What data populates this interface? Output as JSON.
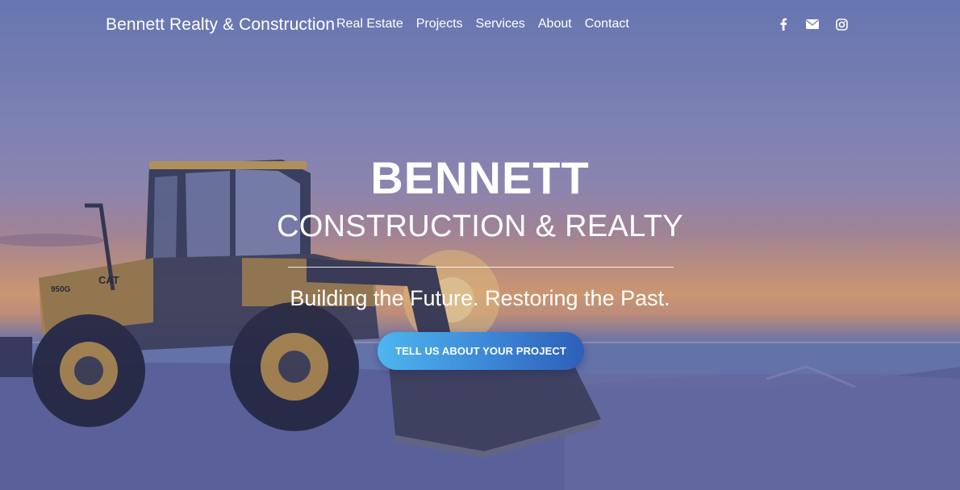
{
  "header": {
    "brand": "Bennett Realty & Construction",
    "nav": [
      "Real Estate",
      "Projects",
      "Services",
      "About",
      "Contact"
    ],
    "social": [
      {
        "icon": "facebook-icon",
        "label": "f"
      },
      {
        "icon": "envelope-icon"
      },
      {
        "icon": "instagram-icon"
      }
    ]
  },
  "hero": {
    "title": "BENNETT",
    "subtitle": "CONSTRUCTION & REALTY",
    "tagline": "Building the Future. Restoring the Past.",
    "cta_label": "TELL US ABOUT YOUR PROJECT",
    "loader_model": "950G",
    "loader_brand": "CAT",
    "background_image": "wheel-loader-on-beach-at-sunset"
  },
  "colors": {
    "overlay": "#4650a0",
    "cta_start": "#4eb6ee",
    "cta_end": "#2d5fb8",
    "text": "#ffffff"
  }
}
